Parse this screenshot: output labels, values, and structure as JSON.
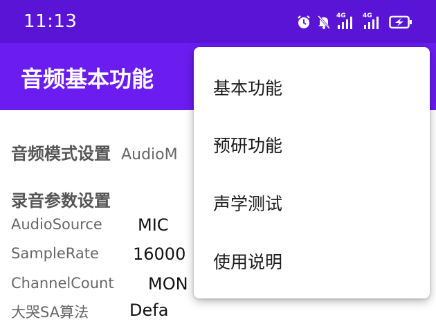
{
  "status_bar": {
    "time": "11:13",
    "icons": [
      "alarm-icon",
      "mute-icon",
      "signal-4g-icon",
      "signal-4g-icon",
      "battery-charging-icon"
    ],
    "signal_labels": [
      "4G",
      "4G"
    ],
    "color": "#5a14d6"
  },
  "app_bar": {
    "title": "音频基本功能",
    "color": "#6b1cf0"
  },
  "content": {
    "audio_mode": {
      "title": "音频模式设置",
      "value": "AudioM"
    },
    "record_params": {
      "title": "录音参数设置",
      "params": [
        {
          "label": "AudioSource",
          "value": "MIC"
        },
        {
          "label": "SampleRate",
          "value": "16000"
        },
        {
          "label": "ChannelCount",
          "value": "MON"
        },
        {
          "label": "大哭SA算法",
          "value": "Defa"
        }
      ]
    }
  },
  "overflow_menu": {
    "items": [
      {
        "label": "基本功能"
      },
      {
        "label": "预研功能"
      },
      {
        "label": "声学测试"
      },
      {
        "label": "使用说明"
      }
    ]
  }
}
